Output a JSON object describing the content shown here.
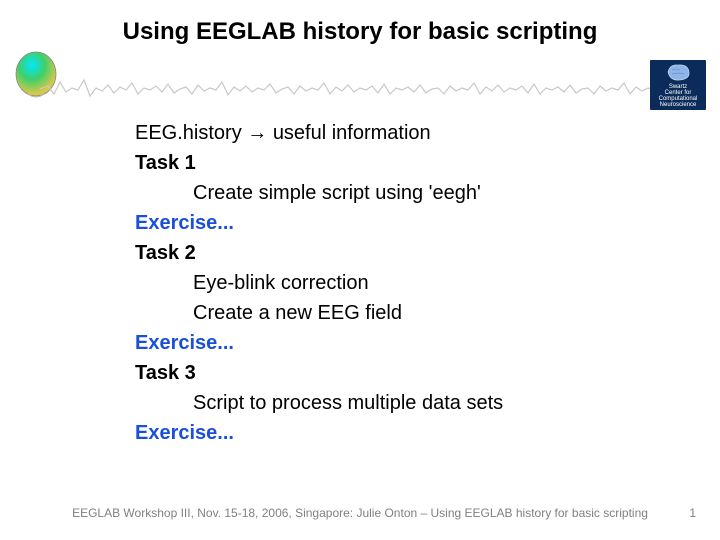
{
  "title": "Using EEGLAB history for basic scripting",
  "logo": {
    "line1": "Swartz",
    "line2": "Center for",
    "line3": "Computational",
    "line4": "Neuroscience"
  },
  "content": {
    "intro": "EEG.history → useful information",
    "task1_label": "Task 1",
    "task1_line1": "Create simple script using 'eegh'",
    "exercise1": "Exercise...",
    "task2_label": "Task 2",
    "task2_line1": "Eye-blink correction",
    "task2_line2": "Create a new EEG field",
    "exercise2": "Exercise...",
    "task3_label": "Task 3",
    "task3_line1": "Script to process multiple data sets",
    "exercise3": "Exercise..."
  },
  "footer": "EEGLAB Workshop III, Nov. 15-18, 2006, Singapore: Julie Onton – Using EEGLAB history for basic scripting",
  "page_number": "1"
}
